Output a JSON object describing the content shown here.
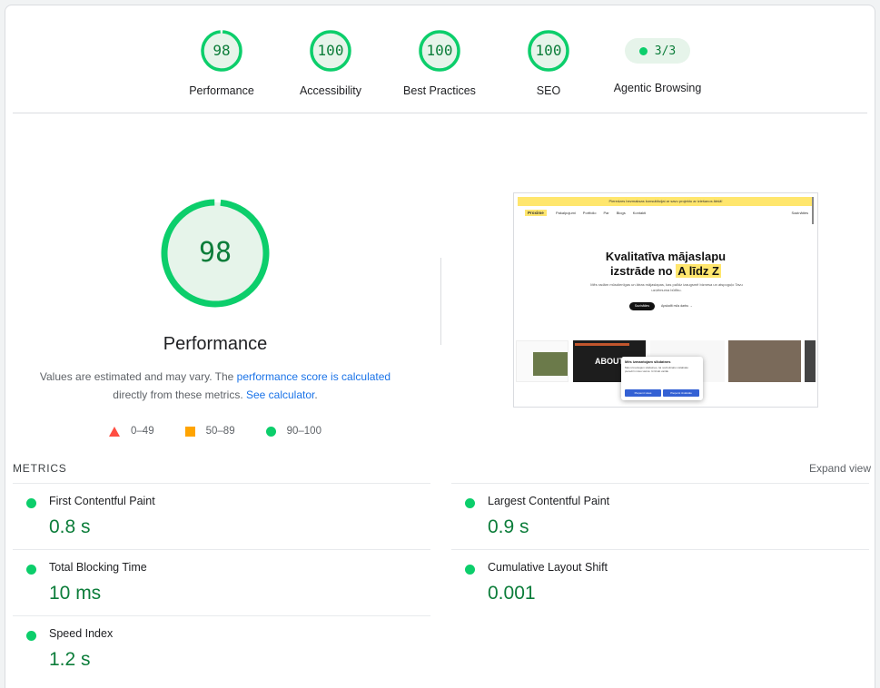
{
  "gauges": [
    {
      "label": "Performance",
      "score": "98",
      "fraction": 0.98
    },
    {
      "label": "Accessibility",
      "score": "100",
      "fraction": 1.0
    },
    {
      "label": "Best Practices",
      "score": "100",
      "fraction": 1.0
    },
    {
      "label": "SEO",
      "score": "100",
      "fraction": 1.0
    }
  ],
  "agentic": {
    "label": "Agentic Browsing",
    "value": "3/3"
  },
  "performance": {
    "score": "98",
    "fraction": 0.98,
    "title": "Performance",
    "desc_part1": "Values are estimated and may vary. The ",
    "desc_link1": "performance score is calculated",
    "desc_part2": " directly from these metrics. ",
    "desc_link2": "See calculator",
    "desc_part3": "."
  },
  "legend": {
    "fail": "0–49",
    "average": "50–89",
    "pass": "90–100"
  },
  "thumbnail": {
    "banner": "Pieredzes bezmaksas konsultācijai ar savu projektu ar iziešanos ābšā!",
    "logo": "Proxime",
    "nav_links": [
      "Pakalpojumi",
      "Portfolio",
      "Par",
      "Blogs",
      "Kontakti"
    ],
    "nav_right": "Sazināties",
    "headline_1": "Kvalitatīva mājaslapu",
    "headline_2a": "izstrāde no",
    "headline_2b": "A līdz Z",
    "subtext": "Mēs radām mūsdienīgas un ātras mājaslapas, kas palīdz izaugsmē biznesa un atspoguļo Tavu uzņēmuma būtību.",
    "btn_primary": "Sazināties",
    "btn_secondary": "Apskatīt mūs darbu →",
    "card_about": "ABOUT",
    "cookie_title": "Mēs izmantojam sīkdatnes",
    "cookie_text": "Mēs izmantojam sīkdatnes, lai nodrošinātu vislabāko pieredzi mūsu vietnē. Uzzināt vairāk",
    "cookie_accept": "Pieņemt visas",
    "cookie_reject": "Pieņemt izvēlētās"
  },
  "metrics": {
    "heading": "METRICS",
    "expand": "Expand view",
    "items": [
      {
        "name": "First Contentful Paint",
        "value": "0.8 s"
      },
      {
        "name": "Largest Contentful Paint",
        "value": "0.9 s"
      },
      {
        "name": "Total Blocking Time",
        "value": "10 ms"
      },
      {
        "name": "Cumulative Layout Shift",
        "value": "0.001"
      },
      {
        "name": "Speed Index",
        "value": "1.2 s"
      }
    ]
  },
  "colors": {
    "pass": "#0cce6b",
    "pass_text": "#0c7d3a",
    "pass_bg": "#e6f4ea",
    "average": "#ffa400",
    "fail": "#ff4e42",
    "link": "#1a73e8"
  }
}
